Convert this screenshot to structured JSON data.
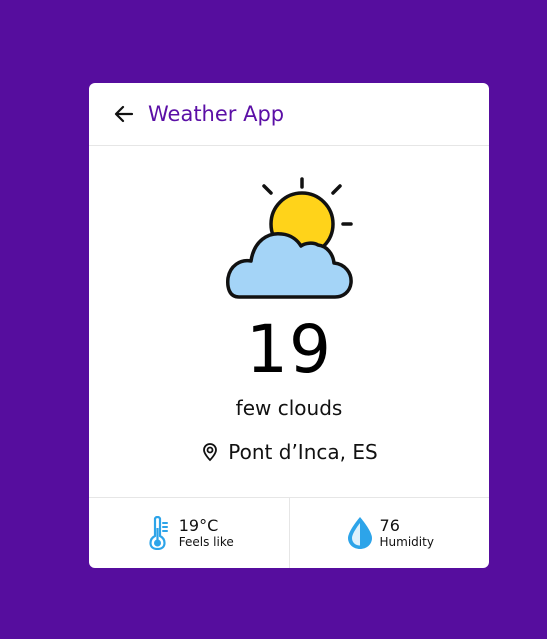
{
  "app": {
    "title": "Weather App"
  },
  "weather": {
    "temperature": "19",
    "description": "few clouds",
    "location": "Pont d’Inca, ES",
    "icon": "sun-behind-cloud-icon"
  },
  "details": {
    "feels_like_value": "19°C",
    "feels_like_label": "Feels like",
    "humidity_value": "76",
    "humidity_label": "Humidity"
  },
  "colors": {
    "background": "#560d9e",
    "accent": "#5b0fa6",
    "icon_blue": "#2da4e9",
    "sun": "#ffd31a",
    "cloud": "#a4d4f7"
  }
}
